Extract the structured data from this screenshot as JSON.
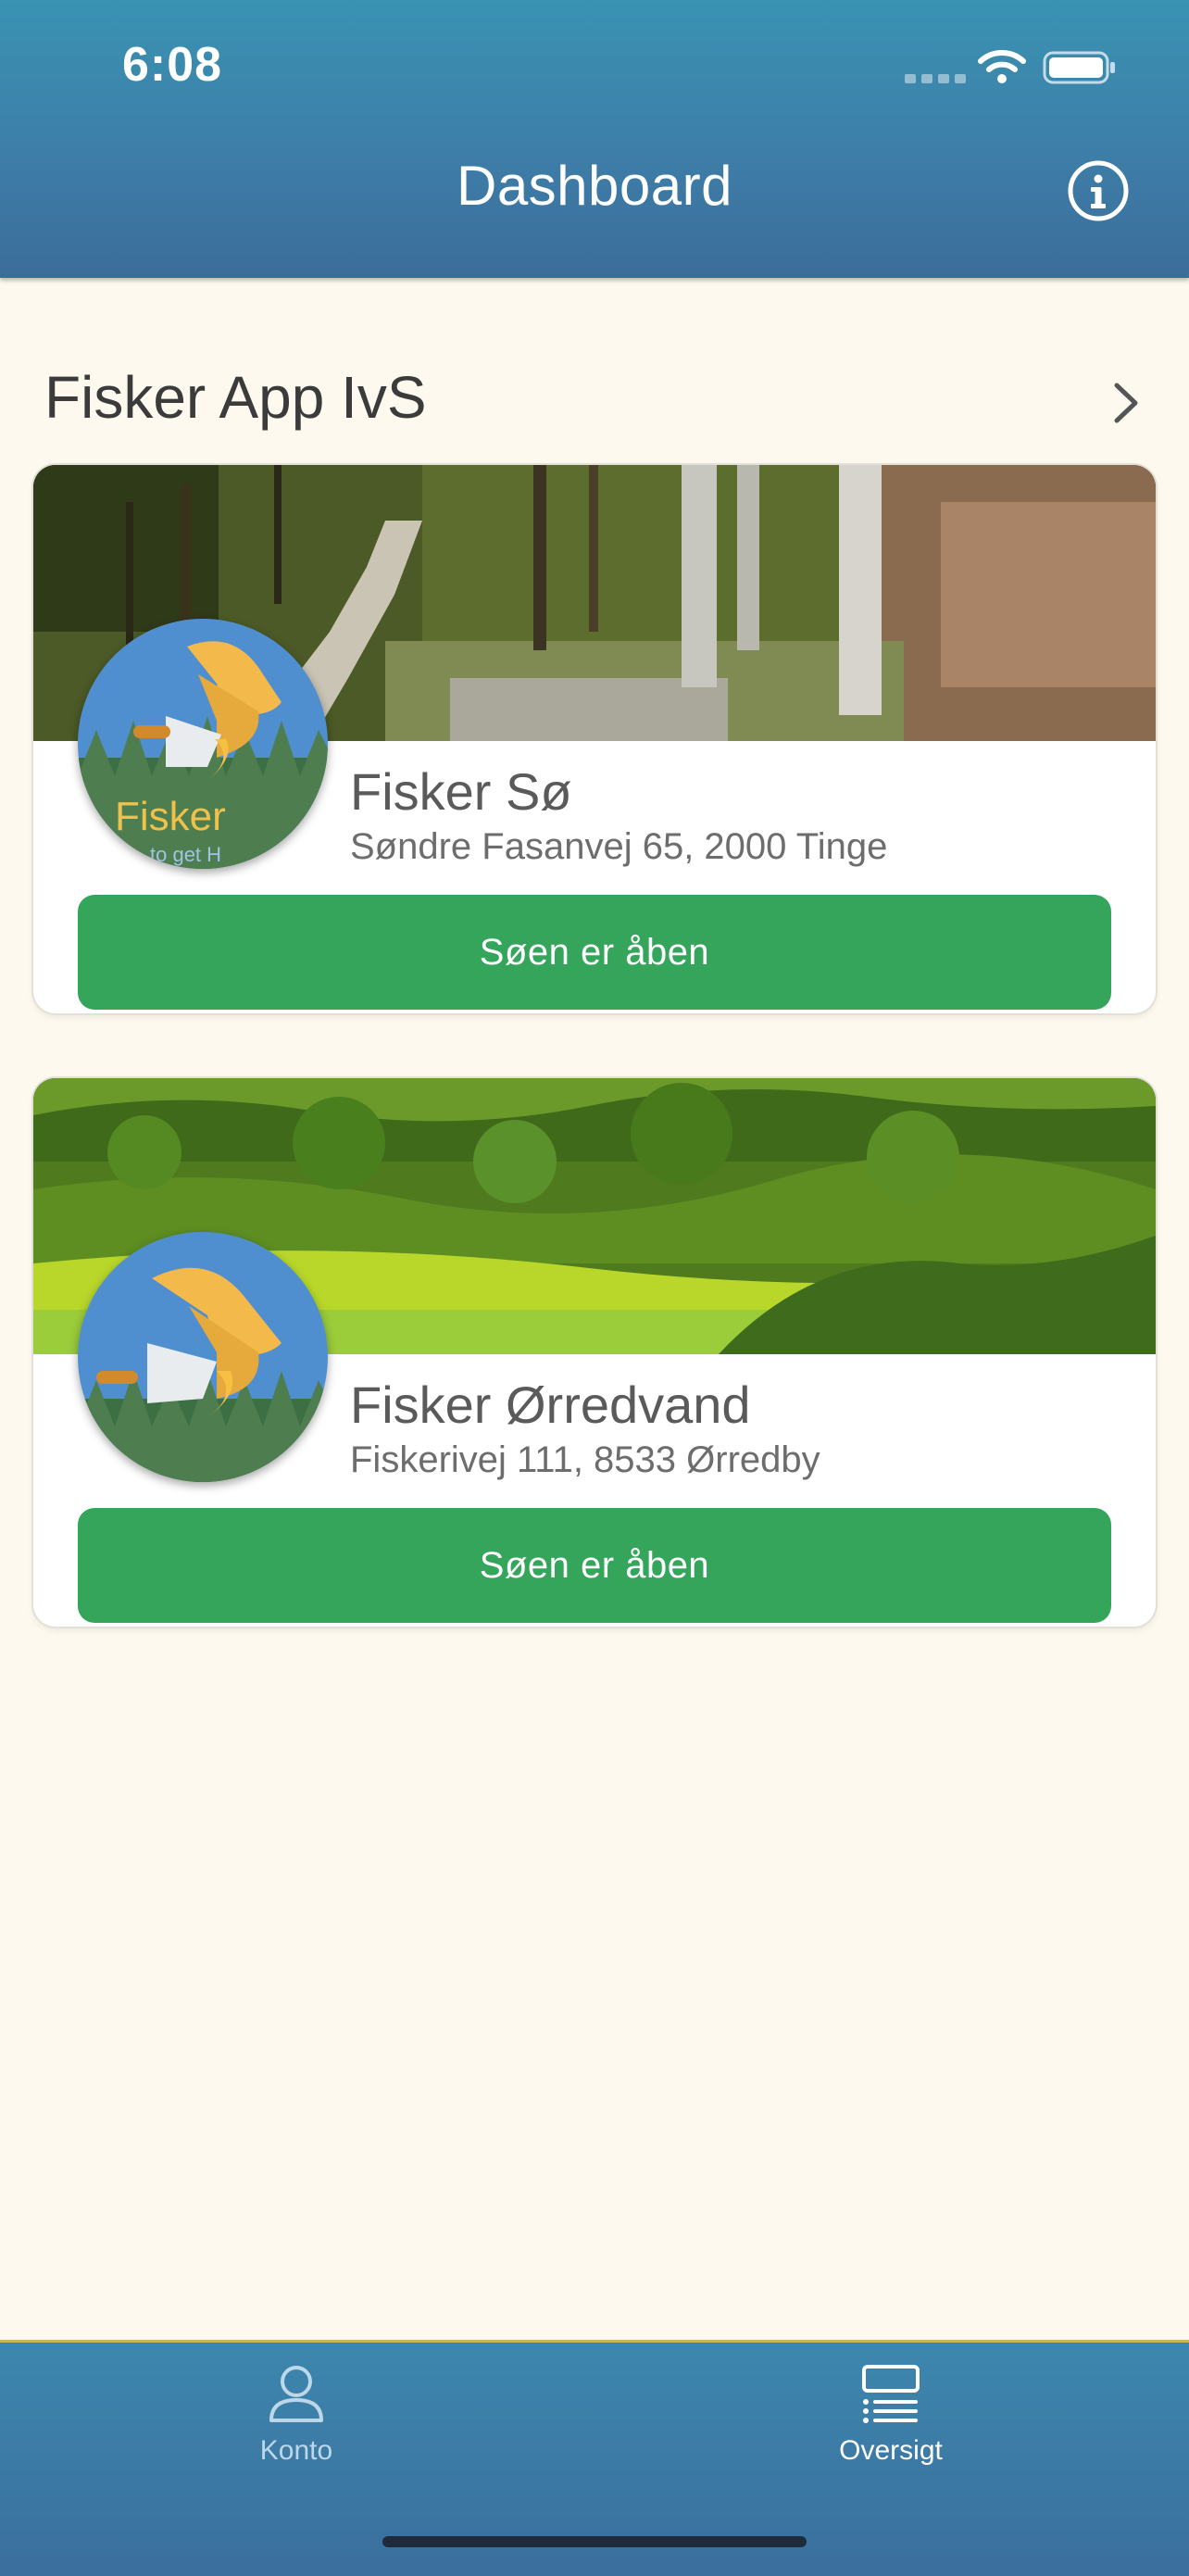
{
  "status_bar": {
    "time": "6:08"
  },
  "header": {
    "title": "Dashboard"
  },
  "section": {
    "title": "Fisker App IvS"
  },
  "lakes": [
    {
      "name": "Fisker Sø",
      "address": "Søndre Fasanvej 65, 2000 Tinge",
      "status_button": "Søen er åben",
      "avatar_text": "Fisker",
      "avatar_subtext": "to get H"
    },
    {
      "name": "Fisker Ørredvand",
      "address": "Fiskerivej 111, 8533 Ørredby",
      "status_button": "Søen er åben"
    }
  ],
  "tabbar": {
    "items": [
      {
        "label": "Konto",
        "icon": "person-icon"
      },
      {
        "label": "Oversigt",
        "icon": "list-icon"
      }
    ]
  },
  "colors": {
    "header": "#3d7ea8",
    "background": "#fdf9ef",
    "button": "#34a55b"
  }
}
